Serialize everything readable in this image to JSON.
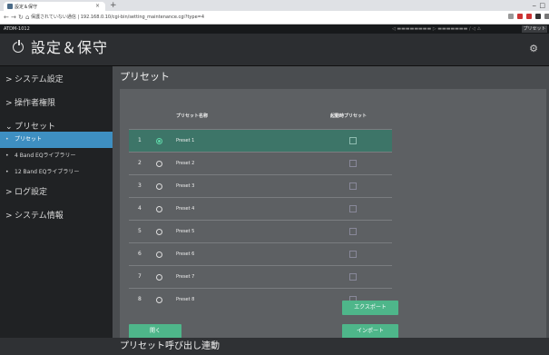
{
  "browser": {
    "tab_title": "設定＆保守",
    "tab_close": "×",
    "new_tab": "+",
    "window_min": "‒",
    "window_max": "□",
    "url": "保護されていない通信 | 192.168.0.10/cgi-bin/setting_maintenance.cgi?type=4"
  },
  "app": {
    "model": "ATDM-1012",
    "title": "設定＆保守",
    "header_preset_label": "プリセット",
    "header_status": "◁ ▬▬▬▬▬▬▬▬  ▷ ▬▬▬▬▬▬▬  ∕ ◁ ⚠"
  },
  "sidebar": {
    "items": [
      {
        "label": "システム設定",
        "arrow": ">"
      },
      {
        "label": "操作者権限",
        "arrow": ">"
      },
      {
        "label": "プリセット",
        "arrow": "⌄"
      },
      {
        "label": "プリセット",
        "arrow": "•"
      },
      {
        "label": "4 Band EQライブラリー",
        "arrow": "•"
      },
      {
        "label": "12 Band EQライブラリー",
        "arrow": "•"
      },
      {
        "label": "ログ設定",
        "arrow": ">"
      },
      {
        "label": "システム情報",
        "arrow": ">"
      }
    ]
  },
  "main": {
    "section_title": "プリセット",
    "table": {
      "col_name": "プリセット名称",
      "col_startup": "起動時プリセット",
      "rows": [
        {
          "num": "1",
          "name": "Preset 1",
          "selected": true
        },
        {
          "num": "2",
          "name": "Preset 2",
          "selected": false
        },
        {
          "num": "3",
          "name": "Preset 3",
          "selected": false
        },
        {
          "num": "4",
          "name": "Preset 4",
          "selected": false
        },
        {
          "num": "5",
          "name": "Preset 5",
          "selected": false
        },
        {
          "num": "6",
          "name": "Preset 6",
          "selected": false
        },
        {
          "num": "7",
          "name": "Preset 7",
          "selected": false
        },
        {
          "num": "8",
          "name": "Preset 8",
          "selected": false
        }
      ]
    },
    "buttons": {
      "export": "エクスポート",
      "import": "インポート",
      "open": "開く"
    },
    "bottom_section_title": "プリセット呼び出し連動"
  },
  "colors": {
    "accent_green": "#4eb68a",
    "active_blue": "#3e8fc2",
    "selected_row": "#3d7568"
  }
}
